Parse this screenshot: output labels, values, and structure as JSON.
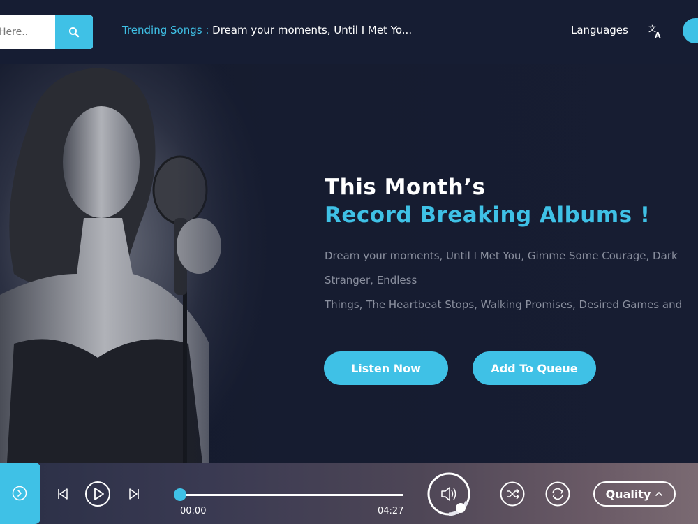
{
  "header": {
    "search_placeholder": "Search Here..",
    "search_visible": "Here..",
    "trending_label": "Trending Songs :",
    "trending_songs": "Dream your moments, Until I Met Yo...",
    "languages_label": "Languages",
    "icons": {
      "search": "search-icon",
      "language": "translate-icon"
    }
  },
  "hero": {
    "title": "This Month’s",
    "subtitle": "Record Breaking Albums !",
    "lines": [
      "Dream your moments, Until I Met You, Gimme Some Courage, Dark",
      "Stranger, Endless",
      "Things, The Heartbeat Stops, Walking Promises, Desired Games and"
    ],
    "listen_label": "Listen Now",
    "queue_label": "Add To Queue"
  },
  "player": {
    "current_time": "00:00",
    "total_time": "04:27",
    "progress": 0,
    "quality_label": "Quality",
    "icons": [
      "chevron-right-icon",
      "previous-icon",
      "play-icon",
      "next-icon",
      "volume-icon",
      "shuffle-icon",
      "repeat-icon",
      "chevron-up-icon"
    ]
  },
  "colors": {
    "accent": "#3fc1e6",
    "background": "#131a2e",
    "header": "#161d33"
  }
}
